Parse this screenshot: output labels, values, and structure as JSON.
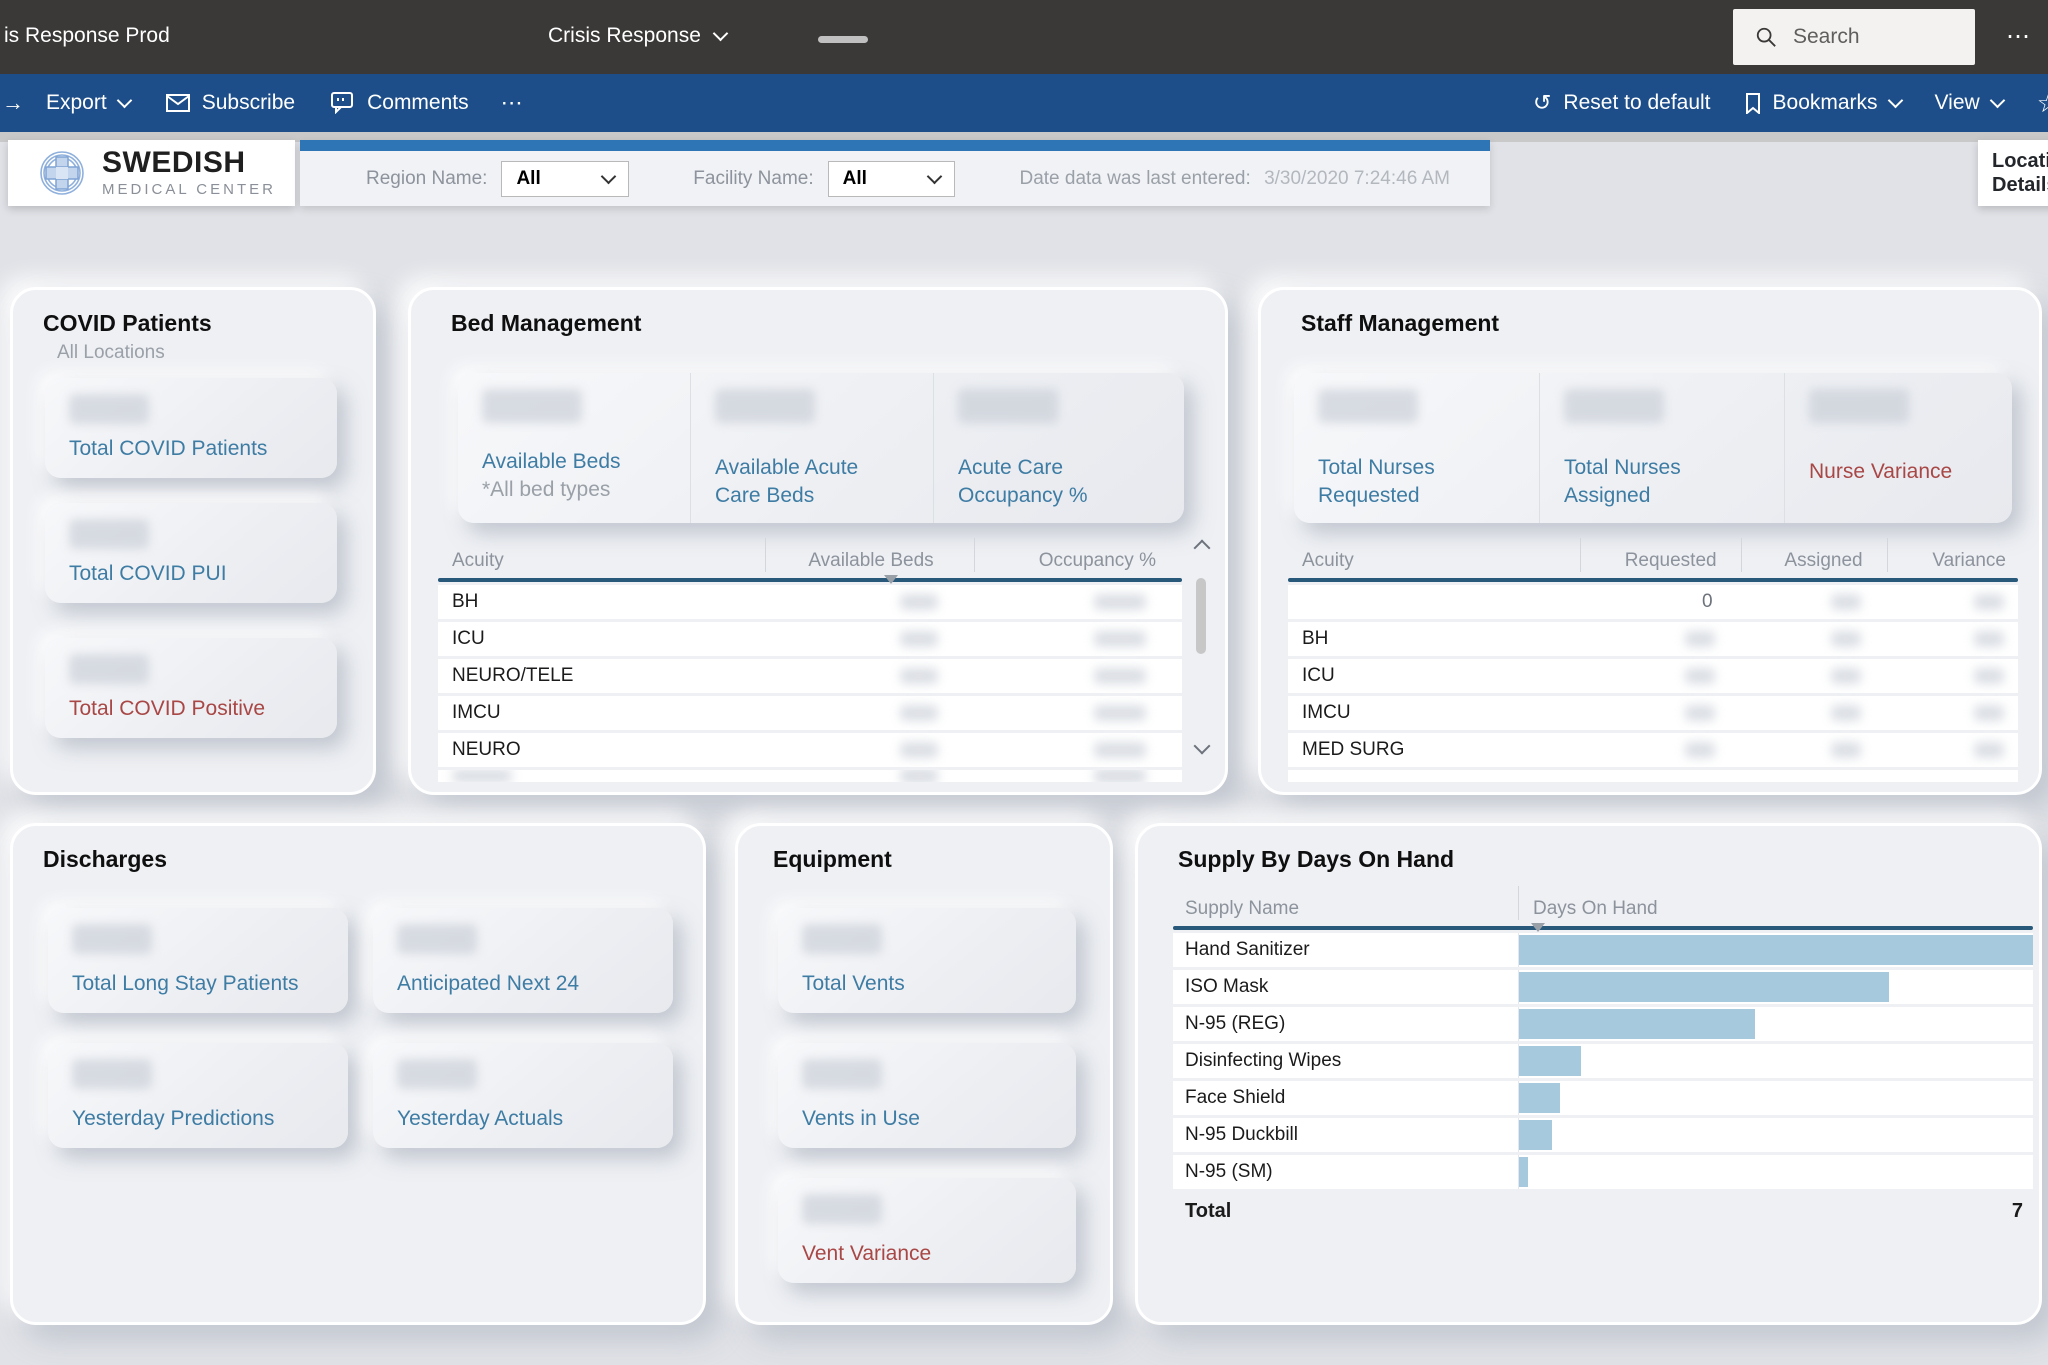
{
  "titlebar": {
    "app_name": "is Response Prod",
    "page_title": "Crisis Response",
    "search_placeholder": "Search",
    "more_glyph": "⋯"
  },
  "actionbar": {
    "arrow_glyph": "→",
    "export_label": "Export",
    "subscribe_label": "Subscribe",
    "comments_label": "Comments",
    "more_glyph": "⋯",
    "undo_glyph": "↺",
    "reset_label": "Reset to default",
    "bookmarks_label": "Bookmarks",
    "view_label": "View",
    "star_glyph": "☆"
  },
  "header": {
    "logo_line1": "SWEDISH",
    "logo_line2": "MEDICAL CENTER",
    "region_label": "Region Name:",
    "region_value": "All",
    "facility_label": "Facility Name:",
    "facility_value": "All",
    "date_label": "Date data was last entered:",
    "date_value": "3/30/2020 7:24:46 AM",
    "location_button": "Location Details"
  },
  "panels": {
    "covid": {
      "title": "COVID Patients",
      "subtitle": "All Locations",
      "kpis": [
        {
          "label": "Total COVID Patients",
          "color": "blue",
          "value_redacted": true
        },
        {
          "label": "Total COVID PUI",
          "color": "blue",
          "value_redacted": true
        },
        {
          "label": "Total COVID Positive",
          "color": "red",
          "value_redacted": true
        }
      ]
    },
    "bed": {
      "title": "Bed Management",
      "kpis": [
        {
          "label": "Available Beds",
          "note": "*All bed types",
          "value_redacted": true
        },
        {
          "label": "Available Acute Care Beds",
          "value_redacted": true
        },
        {
          "label": "Acute Care Occupancy %",
          "value_redacted": true
        }
      ],
      "table": {
        "headers": [
          "Acuity",
          "Available Beds",
          "Occupancy %"
        ],
        "rows": [
          {
            "acuity": "BH"
          },
          {
            "acuity": "ICU"
          },
          {
            "acuity": "NEURO/TELE"
          },
          {
            "acuity": "IMCU"
          },
          {
            "acuity": "NEURO"
          }
        ]
      }
    },
    "staff": {
      "title": "Staff Management",
      "kpis": [
        {
          "label": "Total Nurses Requested",
          "color": "blue",
          "value_redacted": true
        },
        {
          "label": "Total Nurses Assigned",
          "color": "blue",
          "value_redacted": true
        },
        {
          "label": "Nurse Variance",
          "color": "red",
          "value_redacted": true
        }
      ],
      "table": {
        "headers": [
          "Acuity",
          "Requested",
          "Assigned",
          "Variance"
        ],
        "rows": [
          {
            "acuity": "",
            "requested": "0"
          },
          {
            "acuity": "BH"
          },
          {
            "acuity": "ICU"
          },
          {
            "acuity": "IMCU"
          },
          {
            "acuity": "MED SURG"
          }
        ]
      }
    },
    "discharges": {
      "title": "Discharges",
      "kpis": [
        {
          "label": "Total Long Stay Patients",
          "value_redacted": true
        },
        {
          "label": "Anticipated Next 24",
          "value_redacted": true
        },
        {
          "label": "Yesterday Predictions",
          "value_redacted": true
        },
        {
          "label": "Yesterday Actuals",
          "value_redacted": true
        }
      ]
    },
    "equipment": {
      "title": "Equipment",
      "kpis": [
        {
          "label": "Total Vents",
          "color": "blue",
          "value_redacted": true
        },
        {
          "label": "Vents in Use",
          "color": "blue",
          "value_redacted": true
        },
        {
          "label": "Vent Variance",
          "color": "red",
          "value_redacted": true
        }
      ]
    },
    "supply": {
      "title": "Supply By Days On Hand",
      "headers": [
        "Supply Name",
        "Days On Hand"
      ],
      "rows": [
        {
          "name": "Hand Sanitizer",
          "bar_pct": 100,
          "value_redacted": true
        },
        {
          "name": "ISO Mask",
          "bar_pct": 72,
          "value_redacted": true
        },
        {
          "name": "N-95 (REG)",
          "bar_pct": 46,
          "value_redacted": true
        },
        {
          "name": "Disinfecting Wipes",
          "bar_pct": 12,
          "value_redacted": true
        },
        {
          "name": "Face Shield",
          "bar_pct": 8,
          "value_redacted": true
        },
        {
          "name": "N-95 Duckbill",
          "bar_pct": 6.5,
          "value_redacted": true
        },
        {
          "name": "N-95 (SM)",
          "bar_pct": 1.7,
          "value_redacted": true
        }
      ],
      "total_label": "Total",
      "total_value": "7"
    }
  },
  "colors": {
    "titlebar_bg": "#3a3938",
    "actionbar_bg": "#1d4e89",
    "filter_accent": "#2e75b6",
    "page_bg": "#e0e2e7",
    "kpi_blue": "#3e7ca4",
    "kpi_red": "#a84745",
    "bar_fill": "#a7c9dd",
    "table_header_line": "#28587a"
  }
}
